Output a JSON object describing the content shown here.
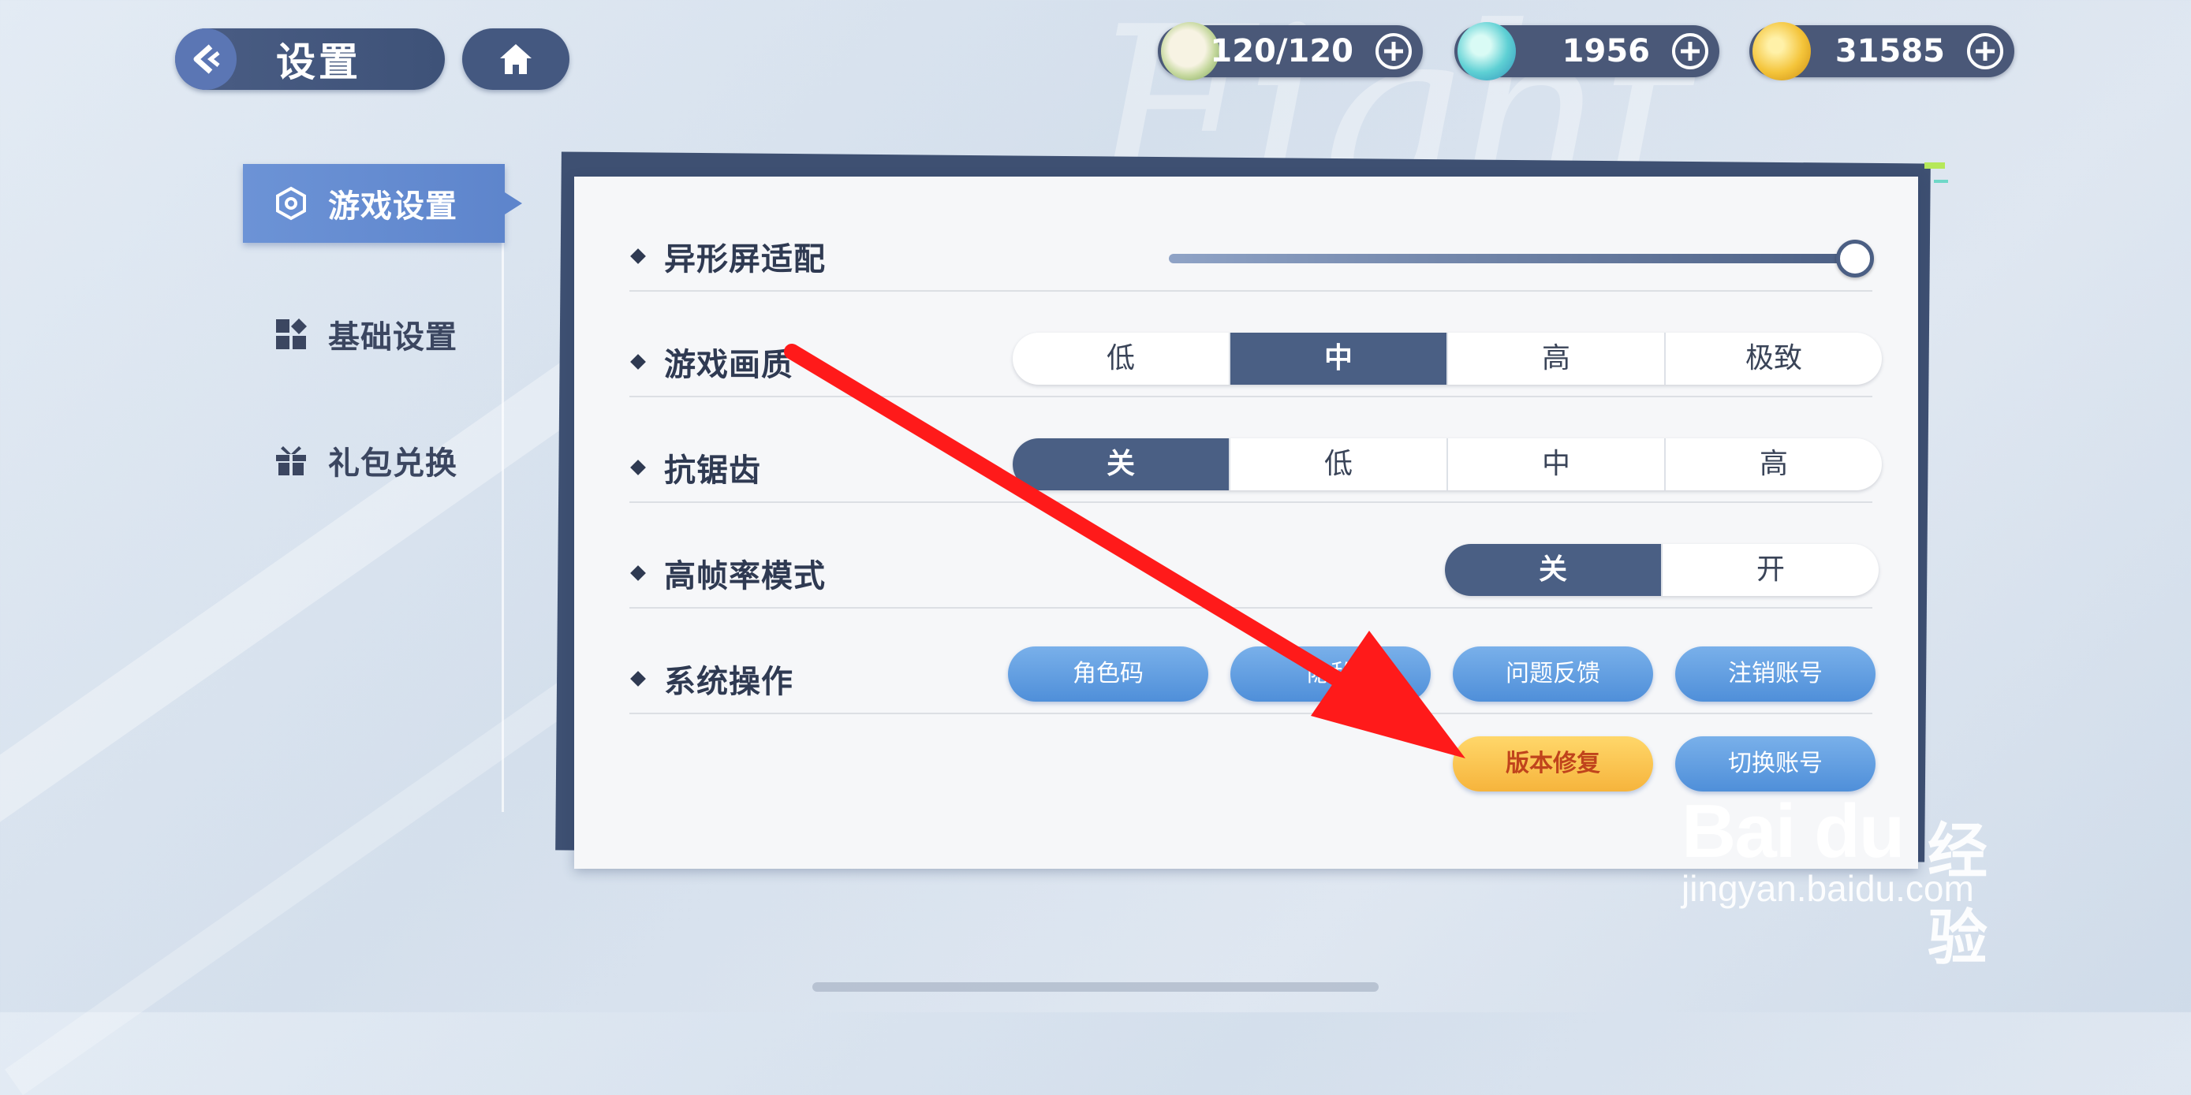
{
  "header": {
    "title": "设置"
  },
  "resources": [
    {
      "icon": "bun-icon",
      "value": "120/120"
    },
    {
      "icon": "cloud-orb-icon",
      "value": "1956"
    },
    {
      "icon": "gold-coin-icon",
      "value": "31585"
    }
  ],
  "sidebar": {
    "items": [
      {
        "label": "游戏设置",
        "icon": "hexagon-gear-icon",
        "active": true
      },
      {
        "label": "基础设置",
        "icon": "grid-icon",
        "active": false
      },
      {
        "label": "礼包兑换",
        "icon": "gift-icon",
        "active": false
      }
    ]
  },
  "settings": {
    "screen_adapt": {
      "label": "异形屏适配",
      "value": 1.0
    },
    "quality": {
      "label": "游戏画质",
      "options": [
        "低",
        "中",
        "高",
        "极致"
      ],
      "selected": "中"
    },
    "antialias": {
      "label": "抗锯齿",
      "options": [
        "关",
        "低",
        "中",
        "高"
      ],
      "selected": "关"
    },
    "high_fps": {
      "label": "高帧率模式",
      "options": [
        "关",
        "开"
      ],
      "selected": "关"
    },
    "system": {
      "label": "系统操作",
      "buttons": [
        "角色码",
        "隐私",
        "问题反馈",
        "注销账号"
      ],
      "buttons2": [
        "版本修复",
        "切换账号"
      ]
    }
  },
  "colors": {
    "accent": "#4a5f84",
    "highlight": "#f6b43c",
    "arrow": "#ff1a1a"
  },
  "watermark": {
    "logo": "Bai du",
    "cn": "经验",
    "url": "jingyan.baidu.com"
  }
}
